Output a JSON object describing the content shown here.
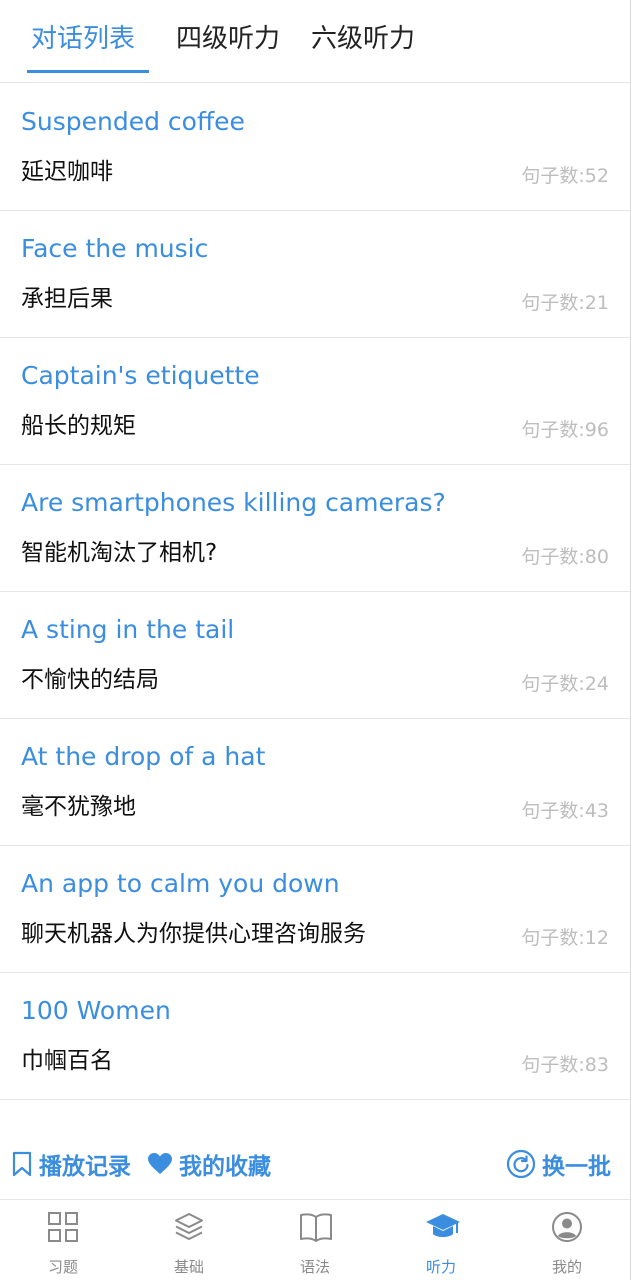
{
  "tabs": [
    {
      "label": "对话列表",
      "active": true
    },
    {
      "label": "四级听力",
      "active": false
    },
    {
      "label": "六级听力",
      "active": false
    }
  ],
  "dialogues": [
    {
      "title": "Suspended coffee",
      "subtitle": "延迟咖啡",
      "count": "句子数:52"
    },
    {
      "title": "Face the music",
      "subtitle": "承担后果",
      "count": "句子数:21"
    },
    {
      "title": "Captain's etiquette",
      "subtitle": "船长的规矩",
      "count": "句子数:96"
    },
    {
      "title": "Are smartphones killing cameras?",
      "subtitle": "智能机淘汰了相机?",
      "count": "句子数:80"
    },
    {
      "title": "A sting in the tail",
      "subtitle": "不愉快的结局",
      "count": "句子数:24"
    },
    {
      "title": "At the drop of a hat",
      "subtitle": "毫不犹豫地",
      "count": "句子数:43"
    },
    {
      "title": "An app to calm you down",
      "subtitle": "聊天机器人为你提供心理咨询服务",
      "count": "句子数:12"
    },
    {
      "title": "100 Women",
      "subtitle": "巾帼百名",
      "count": "句子数:83"
    }
  ],
  "actions": {
    "history_label": "播放记录",
    "favorites_label": "我的收藏",
    "refresh_label": "换一批"
  },
  "bottom_nav": [
    {
      "label": "习题",
      "icon": "grid-icon",
      "active": false
    },
    {
      "label": "基础",
      "icon": "layers-icon",
      "active": false
    },
    {
      "label": "语法",
      "icon": "book-icon",
      "active": false
    },
    {
      "label": "听力",
      "icon": "graduation-cap-icon",
      "active": true
    },
    {
      "label": "我的",
      "icon": "user-icon",
      "active": false
    }
  ],
  "colors": {
    "accent": "#3b8de0",
    "muted": "#bdbdbd",
    "nav_inactive": "#8a8a8a"
  }
}
